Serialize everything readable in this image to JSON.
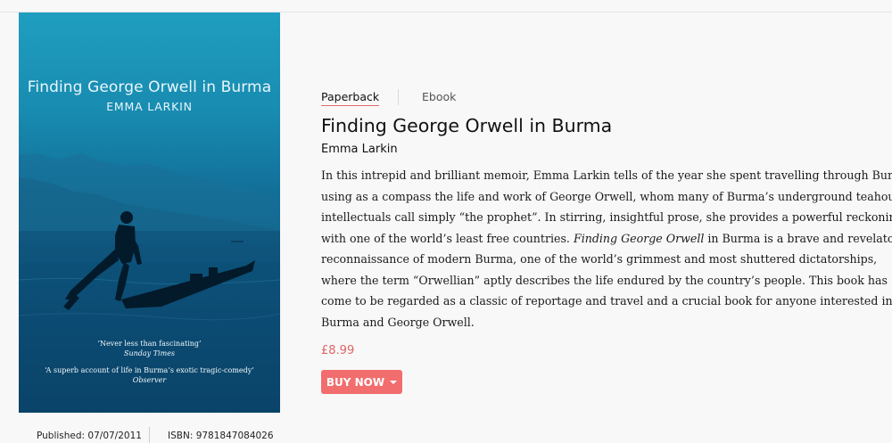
{
  "cover": {
    "title": "Finding George Orwell in Burma",
    "author": "EMMA LARKIN",
    "quotes": [
      {
        "text": "‘Never less than fascinating’",
        "source": "Sunday Times"
      },
      {
        "text": "‘A superb account of life in Burma’s exotic tragic-comedy’",
        "source": "Observer"
      }
    ]
  },
  "meta": {
    "published": "Published: 07/07/2011",
    "isbn": "ISBN: 9781847084026"
  },
  "tabs": [
    {
      "label": "Paperback",
      "active": true
    },
    {
      "label": "Ebook",
      "active": false
    }
  ],
  "book": {
    "title": "Finding George Orwell in Burma",
    "author": "Emma Larkin",
    "description_lines": [
      "In this intrepid and brilliant memoir, Emma Larkin tells of the year she spent travelling through Burma,",
      "using as a compass the life and work of George Orwell, whom many of Burma’s underground teahouse",
      "intellectuals call simply “the prophet”. In stirring, insightful prose, she provides a powerful reckoning",
      "with one of the world’s least free countries.",
      "reconnaissance of modern Burma, one of the world’s grimmest and most shuttered dictatorships,",
      "where the term “Orwellian” aptly describes the life endured by the country’s people. This book has",
      "come to be regarded as a classic of reportage and travel and a crucial book for anyone interested in",
      "Burma and George Orwell."
    ],
    "description_italic": "Finding George Orwell",
    "description_line4_tail": " in Burma is a brave and revelatory",
    "price": "£8.99",
    "buy_label": "BUY NOW"
  },
  "colors": {
    "accent": "#f26d6d",
    "price": "#e06464",
    "cover_top": "#1f9ec0",
    "cover_bottom": "#0a3f62"
  }
}
